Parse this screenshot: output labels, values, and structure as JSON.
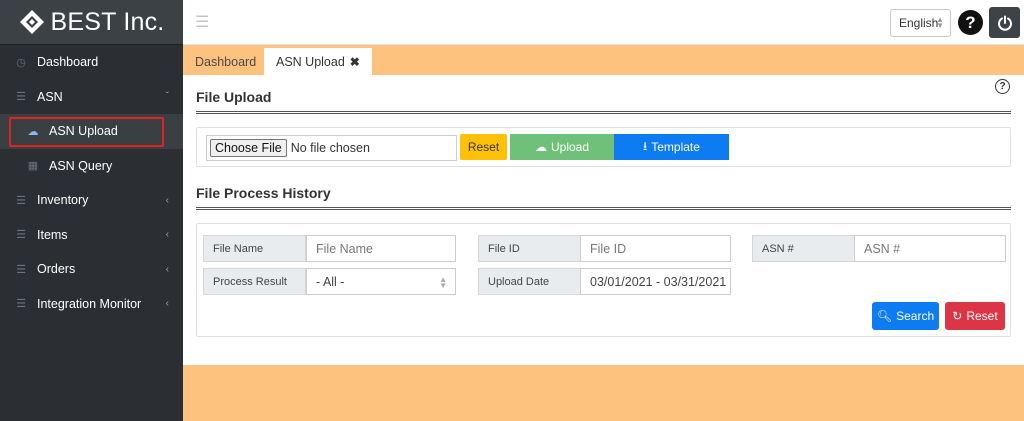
{
  "brand": {
    "name": "BEST Inc.",
    "logo_icon": "best-logo-icon"
  },
  "sidebar": {
    "items": [
      {
        "label": "Dashboard",
        "icon": "dashboard-icon"
      },
      {
        "label": "ASN",
        "icon": "list-icon",
        "expanded": true
      },
      {
        "label": "ASN Upload",
        "icon": "cloud-upload-icon",
        "active": true
      },
      {
        "label": "ASN Query",
        "icon": "grid-icon"
      },
      {
        "label": "Inventory",
        "icon": "list-icon"
      },
      {
        "label": "Items",
        "icon": "list-icon"
      },
      {
        "label": "Orders",
        "icon": "list-icon"
      },
      {
        "label": "Integration Monitor",
        "icon": "list-icon"
      }
    ]
  },
  "topbar": {
    "language": "English",
    "help_label": "?"
  },
  "tabs": [
    {
      "label": "Dashboard"
    },
    {
      "label": "ASN Upload",
      "closable": true
    }
  ],
  "upload": {
    "title": "File Upload",
    "choose_label": "Choose File",
    "no_file_text": "No file chosen",
    "reset_label": "Reset",
    "upload_label": "Upload",
    "template_label": "Template"
  },
  "history": {
    "title": "File Process History",
    "file_name_label": "File Name",
    "file_name_placeholder": "File Name",
    "file_id_label": "File ID",
    "file_id_placeholder": "File ID",
    "asn_label": "ASN #",
    "asn_placeholder": "ASN #",
    "process_result_label": "Process Result",
    "process_result_value": "- All -",
    "upload_date_label": "Upload Date",
    "upload_date_value": "03/01/2021 - 03/31/2021",
    "search_label": "Search",
    "reset_label": "Reset"
  },
  "colors": {
    "accent_orange": "#fdc27e",
    "sidebar": "#2b2f33",
    "primary": "#0d7bf2",
    "success": "#6fc179",
    "warning": "#ffc107",
    "danger": "#dc3545"
  }
}
